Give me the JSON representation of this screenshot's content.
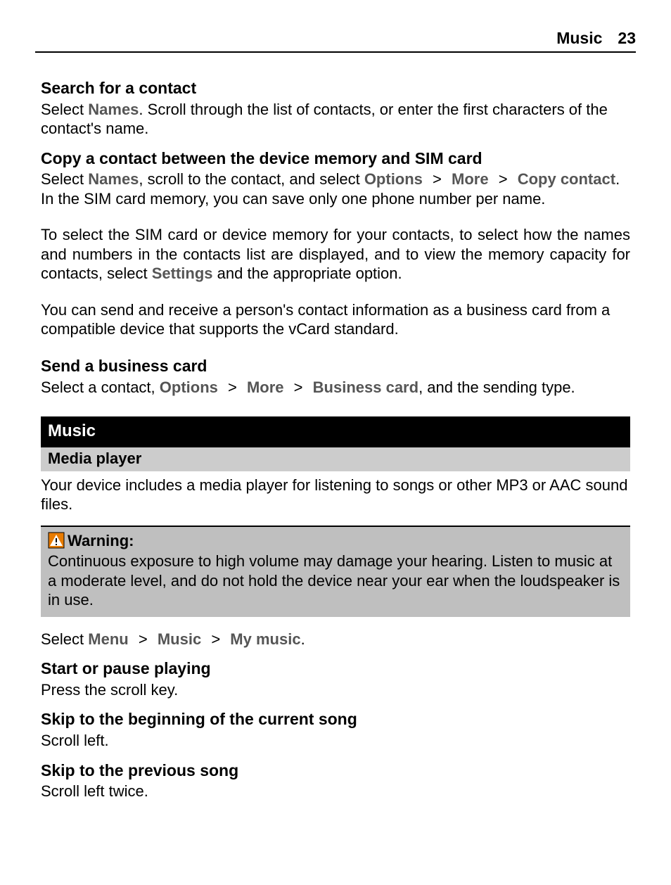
{
  "header": {
    "chapter": "Music",
    "page_number": "23"
  },
  "sections": {
    "search_contact": {
      "title": "Search for a contact",
      "text_1": "Select ",
      "names": "Names",
      "text_2": ". Scroll through the list of contacts, or enter the first characters of the contact's name."
    },
    "copy_contact": {
      "title": "Copy a contact between the device memory and SIM card",
      "text_1": "Select ",
      "names": "Names",
      "text_2": ", scroll to the contact, and select ",
      "options": "Options",
      "gt1": ">",
      "more": "More",
      "gt2": ">",
      "copy_contact": "Copy contact",
      "text_3": ". In the SIM card memory, you can save only one phone number per name."
    },
    "settings_info": {
      "text_1": "To select the SIM card or device memory for your contacts, to select how the names and numbers in the contacts list are displayed, and to view the memory capacity for contacts, select ",
      "settings": "Settings",
      "text_2": " and the appropriate option."
    },
    "vcard_info": {
      "text": "You can send and receive a person's contact information as a business card from a compatible device that supports the vCard standard."
    },
    "send_card": {
      "title": "Send a business card",
      "text_1": "Select a contact, ",
      "options": "Options",
      "gt1": ">",
      "more": "More",
      "gt2": ">",
      "business_card": "Business card",
      "text_2": ", and the sending type."
    }
  },
  "chapter_bar": "Music",
  "media_player_bar": "Media player",
  "media_player_intro": "Your device includes a media player for listening to songs or other MP3 or AAC sound files.",
  "warning": {
    "label": "Warning:",
    "text": "Continuous exposure to high volume may damage your hearing. Listen to music at a moderate level, and do not hold the device near your ear when the loudspeaker is in use."
  },
  "select_my_music": {
    "text_1": "Select ",
    "menu": "Menu",
    "gt1": ">",
    "music": "Music",
    "gt2": ">",
    "my_music": "My music",
    "text_2": "."
  },
  "start_pause": {
    "title": "Start or pause playing",
    "text": "Press the scroll key."
  },
  "skip_beginning": {
    "title": "Skip to the beginning of the current song",
    "text": "Scroll left."
  },
  "skip_previous": {
    "title": "Skip to the previous song",
    "text": "Scroll left twice."
  }
}
